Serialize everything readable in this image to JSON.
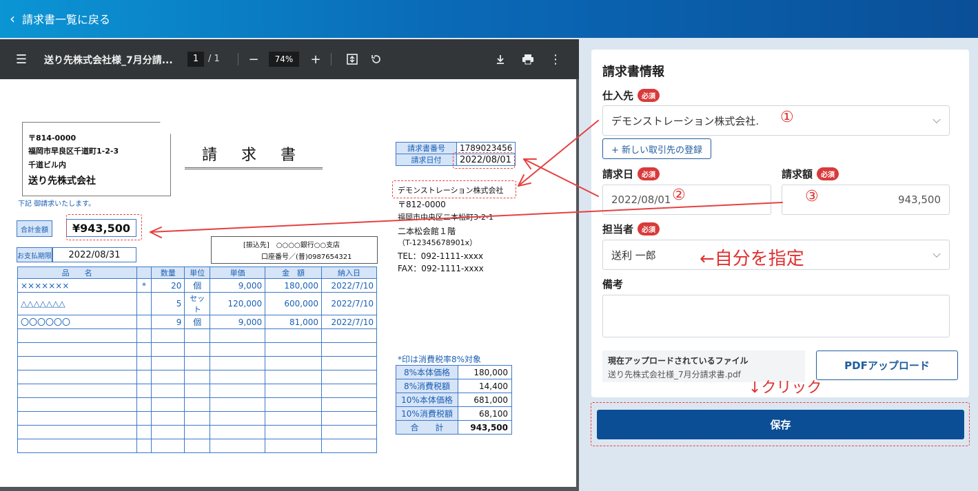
{
  "header": {
    "back_label": "請求書一覧に戻る"
  },
  "viewer": {
    "file_title": "送り先株式会社様_7月分請...",
    "page_current": "1",
    "page_total": "/ 1",
    "zoom": "74%",
    "icons": [
      "menu-icon",
      "zoom-out-icon",
      "zoom-in-icon",
      "fit-page-icon",
      "rotate-icon",
      "download-icon",
      "print-icon",
      "more-vert-icon"
    ]
  },
  "invoice": {
    "recipient": {
      "zip": "〒814-0000",
      "addr1": "福岡市早良区千道町1-2-3",
      "addr2": "千道ビル内",
      "name": "送り先株式会社"
    },
    "title": "請 求 書",
    "note": "下記 御請求いたします。",
    "total_label": "合計金額",
    "total_value": "¥943,500",
    "due_label": "お支払期限",
    "due_value": "2022/08/31",
    "bank_line1": "[振込先]　○○○○銀行○○支店",
    "bank_line2": "口座番号／(普)0987654321",
    "meta": [
      {
        "label": "請求書番号",
        "value": "1789023456"
      },
      {
        "label": "請求日付",
        "value": "2022/08/01"
      }
    ],
    "seller": {
      "name": "デモンストレーション株式会社",
      "zip": "〒812-0000",
      "addr": "福岡市中央区二本松町3-2-1",
      "bldg": "二本松会館１階",
      "reg": "（T-12345678901x）",
      "tel": "TEL：092-1111-xxxx",
      "fax": "FAX：092-1111-xxxx"
    },
    "columns": [
      "品　　名",
      "",
      "数量",
      "単位",
      "単価",
      "金　額",
      "納入日"
    ],
    "rows": [
      [
        "×××××××",
        "*",
        "20",
        "個",
        "9,000",
        "180,000",
        "2022/7/10"
      ],
      [
        "△△△△△△△",
        "",
        "5",
        "セット",
        "120,000",
        "600,000",
        "2022/7/10"
      ],
      [
        "〇〇〇〇〇〇",
        "",
        "9",
        "個",
        "9,000",
        "81,000",
        "2022/7/10"
      ]
    ],
    "tax_note": "*印は消費税率8%対象",
    "tax": [
      {
        "label": "8%本体価格",
        "value": "180,000"
      },
      {
        "label": "8%消費税額",
        "value": "14,400"
      },
      {
        "label": "10%本体価格",
        "value": "681,000"
      },
      {
        "label": "10%消費税額",
        "value": "68,100"
      },
      {
        "label": "合　　計",
        "value": "943,500"
      }
    ]
  },
  "form": {
    "title": "請求書情報",
    "required": "必須",
    "supplier_label": "仕入先",
    "supplier_value": "デモンストレーション株式会社.",
    "new_supplier_button": "+ 新しい取引先の登録",
    "date_label": "請求日",
    "date_value": "2022/08/01",
    "amount_label": "請求額",
    "amount_value": "943,500",
    "person_label": "担当者",
    "person_value": "送利 一郎",
    "memo_label": "備考",
    "memo_value": "",
    "file_label": "現在アップロードされているファイル",
    "file_name": "送り先株式会社様_7月分請求書.pdf",
    "pdf_upload_button": "PDFアップロード",
    "save_button": "保存"
  },
  "annotations": {
    "n1": "①",
    "n2": "②",
    "n3": "③",
    "assign_self": "←自分を指定",
    "click": "↓クリック",
    "color": "#e03030"
  }
}
